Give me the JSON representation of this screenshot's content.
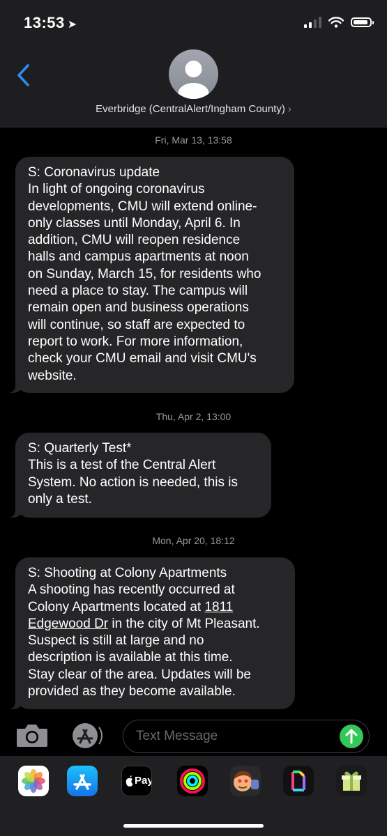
{
  "status_bar": {
    "time": "13:53",
    "location_glyph": "➤"
  },
  "header": {
    "contact_name": "Everbridge (CentralAlert/Ingham County)",
    "chevron": "›"
  },
  "messages": [
    {
      "timestamp": "Fri, Mar 13, 13:58",
      "lines": [
        "S: Coronavirus update",
        "In light of ongoing coronavirus",
        "developments, CMU will extend online-",
        "only classes until Monday, April 6. In",
        "addition, CMU will reopen residence",
        "halls and campus apartments at noon",
        "on Sunday, March 15, for residents who",
        "need a place to stay. The campus will",
        "remain open and business operations",
        "will continue, so staff are expected to",
        "report to work. For more information,",
        "check your CMU email and visit CMU's",
        "website."
      ]
    },
    {
      "timestamp": "Thu, Apr 2, 13:00",
      "lines": [
        "S: Quarterly Test*",
        "This is a test of the Central Alert",
        "System. No action is needed, this is",
        "only a test."
      ]
    },
    {
      "timestamp": "Mon, Apr 20, 18:12",
      "lines": [
        "S: Shooting at Colony Apartments",
        "A shooting has recently occurred at",
        "Colony Apartments located at ",
        "1811",
        "Edgewood Dr",
        " in the city of Mt Pleasant.",
        "Suspect is still at large and no",
        "description is available at this time.",
        "Stay clear of the area. Updates will be",
        "provided as they become available."
      ]
    }
  ],
  "composer": {
    "placeholder": "Text Message"
  },
  "app_tray": {
    "icons": [
      "photos-icon",
      "app-store-icon",
      "apple-pay-icon",
      "activity-icon",
      "memoji-icon",
      "gif-icon",
      "gift-icon"
    ],
    "apple_pay_label": "Pay"
  },
  "colors": {
    "accent_blue": "#2d8cf0",
    "bubble_gray": "#262628",
    "send_green": "#34c759"
  }
}
